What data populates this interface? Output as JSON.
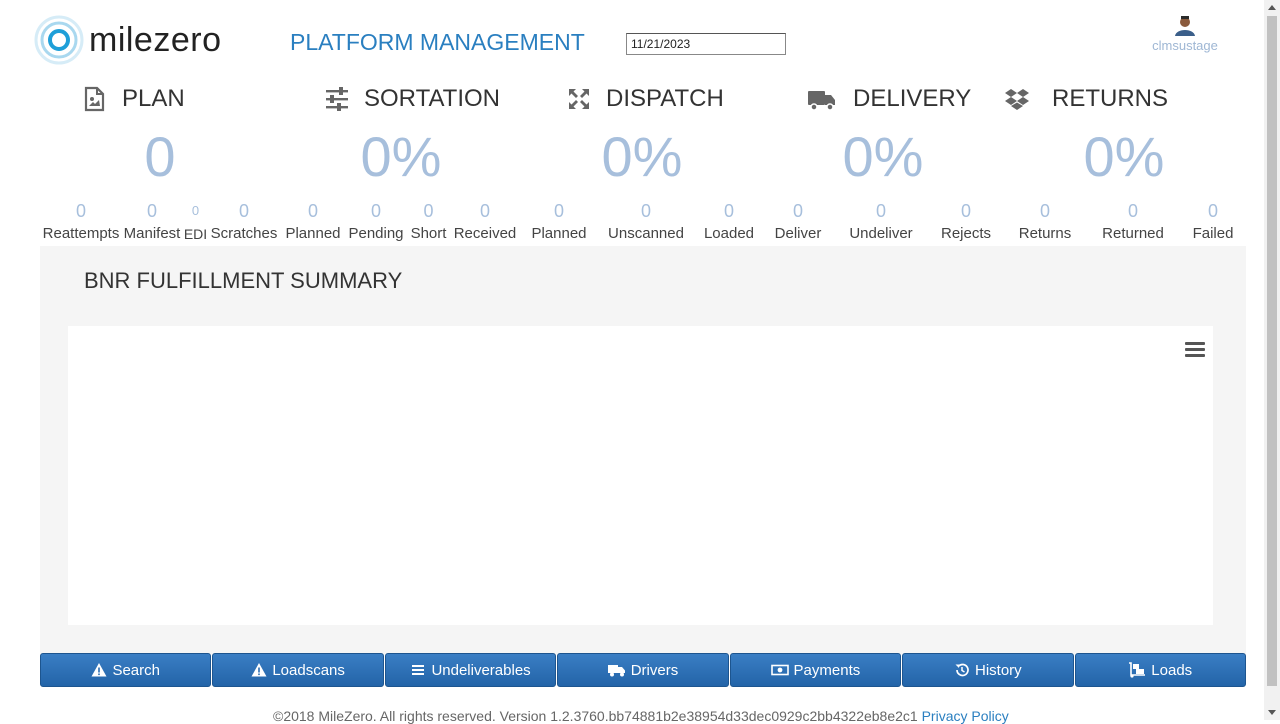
{
  "header": {
    "logo_text": "milezero",
    "title": "PLATFORM MANAGEMENT",
    "date_value": "11/21/2023",
    "username": "clmsustage"
  },
  "sections": [
    {
      "label": "PLAN",
      "big": "0",
      "icon": "file-document-icon"
    },
    {
      "label": "SORTATION",
      "big": "0%",
      "icon": "sliders-icon"
    },
    {
      "label": "DISPATCH",
      "big": "0%",
      "icon": "expand-arrows-icon"
    },
    {
      "label": "DELIVERY",
      "big": "0%",
      "icon": "truck-icon"
    },
    {
      "label": "RETURNS",
      "big": "0%",
      "icon": "dropbox-icon"
    }
  ],
  "stats": [
    {
      "value": "0",
      "label": "Reattempts"
    },
    {
      "value": "0",
      "label": "Manifest"
    },
    {
      "value": "0",
      "label": "EDI"
    },
    {
      "value": "0",
      "label": "Scratches"
    },
    {
      "value": "0",
      "label": "Planned"
    },
    {
      "value": "0",
      "label": "Pending"
    },
    {
      "value": "0",
      "label": "Short"
    },
    {
      "value": "0",
      "label": "Received"
    },
    {
      "value": "0",
      "label": "Planned"
    },
    {
      "value": "0",
      "label": "Unscanned"
    },
    {
      "value": "0",
      "label": "Loaded"
    },
    {
      "value": "0",
      "label": "Deliver"
    },
    {
      "value": "0",
      "label": "Undeliver"
    },
    {
      "value": "0",
      "label": "Rejects"
    },
    {
      "value": "0",
      "label": "Returns"
    },
    {
      "value": "0",
      "label": "Returned"
    },
    {
      "value": "0",
      "label": "Failed"
    }
  ],
  "summary": {
    "title": "BNR FULFILLMENT SUMMARY",
    "menu_icon": "hamburger-menu-icon"
  },
  "buttons": [
    {
      "label": "Search",
      "icon": "warning-icon"
    },
    {
      "label": "Loadscans",
      "icon": "warning-icon"
    },
    {
      "label": "Undeliverables",
      "icon": "list-icon"
    },
    {
      "label": "Drivers",
      "icon": "truck-icon"
    },
    {
      "label": "Payments",
      "icon": "money-bill-icon"
    },
    {
      "label": "History",
      "icon": "history-icon"
    },
    {
      "label": "Loads",
      "icon": "dolly-icon"
    }
  ],
  "footer": {
    "text": "©2018 MileZero. All rights reserved. Version 1.2.3760.bb74881b2e38954d33dec0929c2bb4322eb8e2c1",
    "link": "Privacy Policy"
  },
  "colors": {
    "accent": "#2a7fc0",
    "metric": "#a7bfdc",
    "button": "#2f72b8",
    "panel": "#f5f5f5"
  }
}
